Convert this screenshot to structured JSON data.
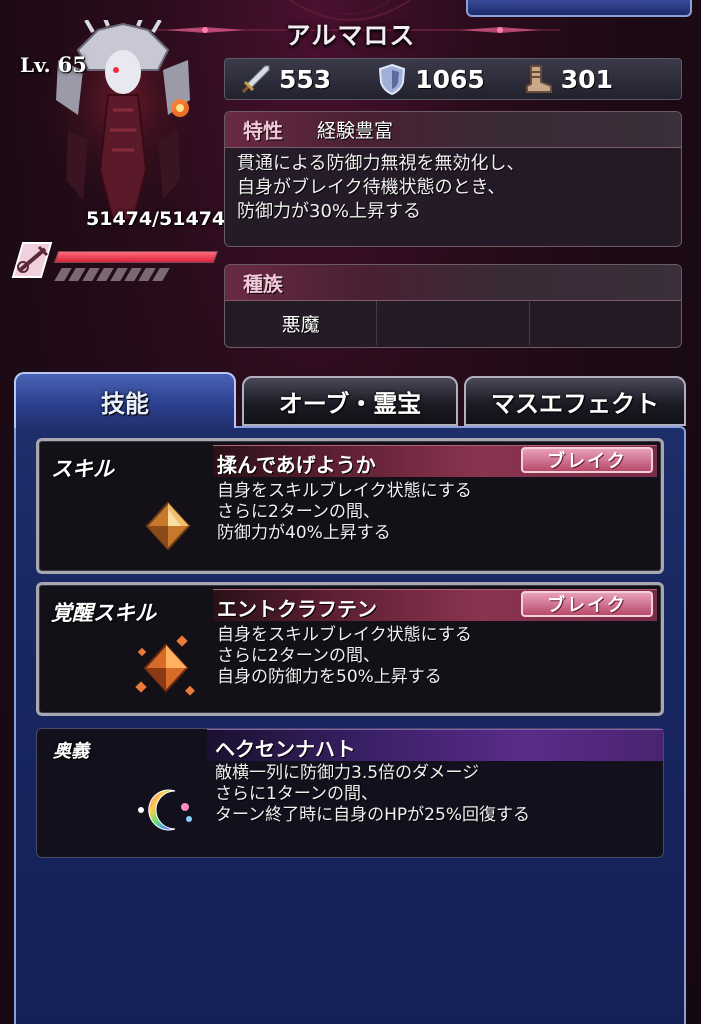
{
  "character": {
    "name": "アルマロス",
    "level_prefix": "Lv.",
    "level": "65",
    "hp": "51474/51474",
    "hp_fraction": 1.0
  },
  "stats": [
    {
      "icon": "sword-icon",
      "value": "553"
    },
    {
      "icon": "shield-icon",
      "value": "1065"
    },
    {
      "icon": "boot-icon",
      "value": "301"
    }
  ],
  "trait": {
    "label": "特性",
    "name": "経験豊富",
    "description": "貫通による防御力無視を無効化し、\n自身がブレイク待機状態のとき、\n防御力が30%上昇する"
  },
  "race": {
    "label": "種族",
    "values": [
      "悪魔",
      "",
      ""
    ]
  },
  "tabs": {
    "skills": "技能",
    "orb": "オーブ・霊宝",
    "mass_effect": "マスエフェクト"
  },
  "skills": [
    {
      "type": "スキル",
      "name": "揉んであげようか",
      "tag": "ブレイク",
      "description": "自身をスキルブレイク状態にする\nさらに2ターンの間、\n防御力が40%上昇する",
      "icon": "amber-crystal-icon"
    },
    {
      "type": "覚醒スキル",
      "name": "エントクラフテン",
      "tag": "ブレイク",
      "description": "自身をスキルブレイク状態にする\nさらに2ターンの間、\n自身の防御力を50%上昇する",
      "icon": "amber-crystal-burst-icon"
    },
    {
      "type": "奥義",
      "name": "ヘクセンナハト",
      "description": "敵横一列に防御力3.5倍のダメージ\nさらに1ターンの間、\nターン終了時に自身のHPが25%回復する",
      "icon": "rainbow-crescent-icon"
    }
  ],
  "colors": {
    "accent_pink": "#f4c8d8",
    "tab_blue": "#2a3e8c",
    "break_tag": "#b84a6c",
    "hp_red": "#d8243c"
  }
}
